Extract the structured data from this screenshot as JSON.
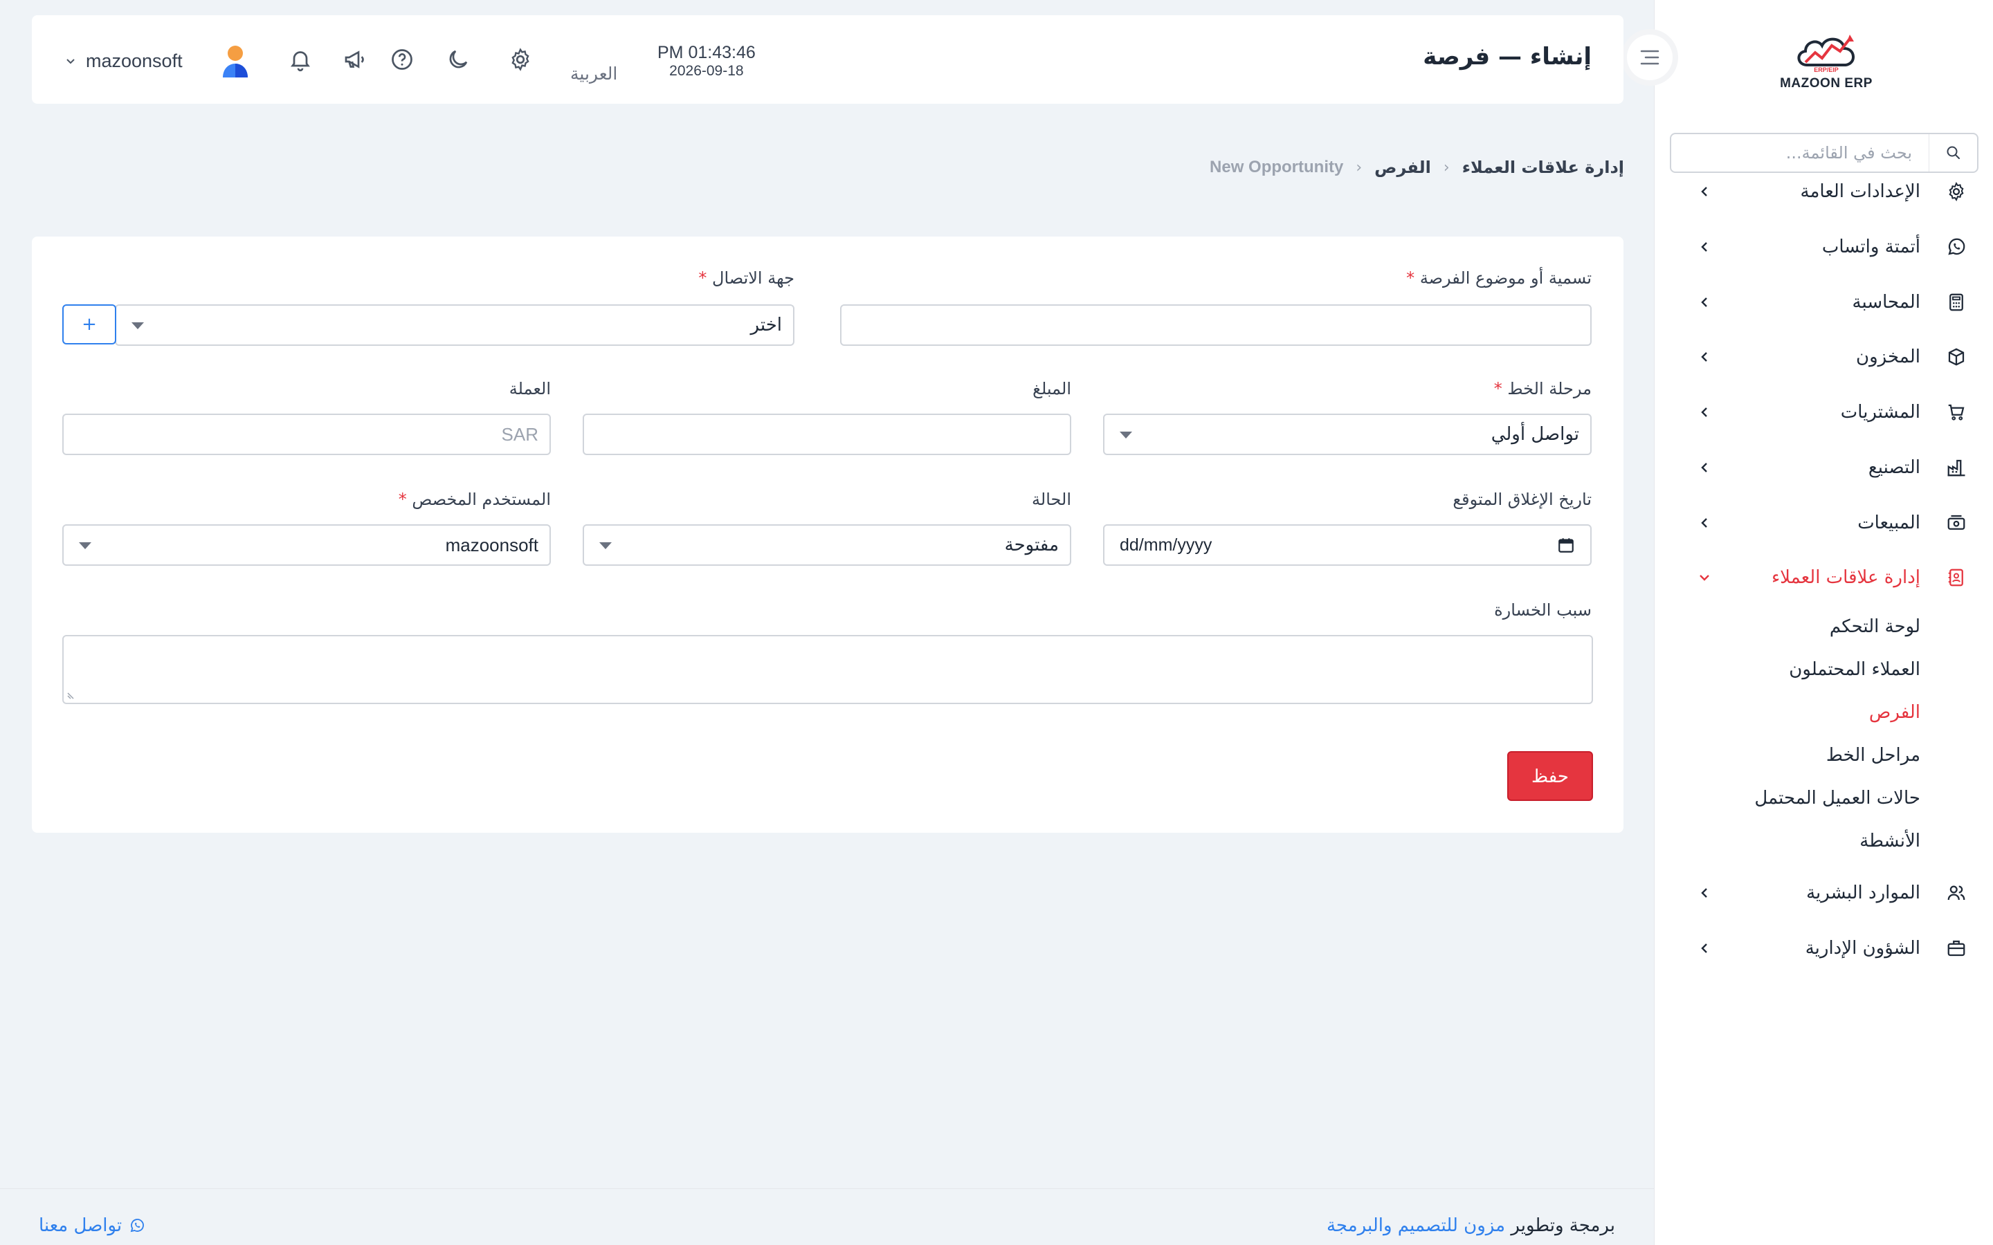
{
  "app": {
    "brand_name": "MAZOON ERP",
    "brand_sub": "ERP/EIP"
  },
  "sidebar": {
    "search_placeholder": "بحث في القائمة...",
    "items": [
      {
        "label": "الإعدادات العامة",
        "icon": "gear-icon"
      },
      {
        "label": "أتمتة واتساب",
        "icon": "whatsapp-icon"
      },
      {
        "label": "المحاسبة",
        "icon": "calculator-icon"
      },
      {
        "label": "المخزون",
        "icon": "box-icon"
      },
      {
        "label": "المشتريات",
        "icon": "cart-icon"
      },
      {
        "label": "التصنيع",
        "icon": "factory-icon"
      },
      {
        "label": "المبيعات",
        "icon": "cash-icon"
      },
      {
        "label": "إدارة علاقات العملاء",
        "icon": "contacts-book-icon",
        "expanded": true
      },
      {
        "label": "الموارد البشرية",
        "icon": "users-icon"
      },
      {
        "label": "الشؤون الإدارية",
        "icon": "briefcase-icon"
      }
    ],
    "crm_sub_items": [
      {
        "label": "لوحة التحكم"
      },
      {
        "label": "العملاء المحتملون"
      },
      {
        "label": "الفرص",
        "active": true
      },
      {
        "label": "مراحل الخط"
      },
      {
        "label": "حالات العميل المحتمل"
      },
      {
        "label": "الأنشطة"
      }
    ]
  },
  "header": {
    "title": "إنشاء — فرصة",
    "time": "PM 01:43:46",
    "date": "2026-09-18",
    "language": "العربية",
    "user": "mazoonsoft"
  },
  "breadcrumb": {
    "items": [
      "إدارة علاقات العملاء",
      "الفرص",
      "New Opportunity"
    ]
  },
  "form": {
    "name_label": "تسمية أو موضوع الفرصة",
    "name_value": "",
    "contact_label": "جهة الاتصال",
    "contact_value": "اختر",
    "add_button": "+",
    "stage_label": "مرحلة الخط",
    "stage_value": "تواصل أولي",
    "amount_label": "المبلغ",
    "amount_value": "",
    "currency_label": "العملة",
    "currency_value": "SAR",
    "close_date_label": "تاريخ الإغلاق المتوقع",
    "close_date_value": "dd/mm/yyyy",
    "status_label": "الحالة",
    "status_value": "مفتوحة",
    "assigned_label": "المستخدم المخصص",
    "assigned_value": "mazoonsoft",
    "loss_reason_label": "سبب الخسارة",
    "loss_reason_value": "",
    "save_button": "حفظ",
    "required_mark": "*"
  },
  "footer": {
    "credit_prefix": "برمجة وتطوير",
    "credit_company": "مزون للتصميم والبرمجة",
    "contact": "تواصل معنا"
  },
  "colors": {
    "accent": "#e5353f",
    "link": "#2f80ed",
    "background": "#eff3f7"
  }
}
